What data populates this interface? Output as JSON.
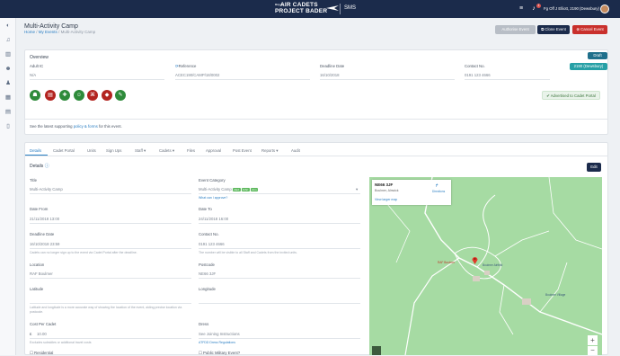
{
  "header": {
    "brand_small": "Royal",
    "brand_line1": "AIR CADETS",
    "brand_line2": "PROJECT BADER",
    "product": "SMS",
    "notification_count": "1",
    "user_name": "Fg Off J Elliott, 2190 (Dewsbury)"
  },
  "page": {
    "title": "Multi-Activity Camp",
    "breadcrumb": {
      "home": "Home",
      "my_events": "My Events",
      "current": "Multi-Activity Camp"
    },
    "buttons": {
      "clone": "Clone Event",
      "cancel": "Cancel Event",
      "disabled": "Authorise Event"
    }
  },
  "overview": {
    "heading": "Overview",
    "status_badge": "Draft",
    "unit_badge": "2190 (Dewsbury)",
    "fields": [
      {
        "label": "Adult IC",
        "value": "N/A"
      },
      {
        "label": "Reference",
        "value": "ACEC190/CAMP/18/0002"
      },
      {
        "label": "Deadline Date",
        "value": "16/10/2018"
      },
      {
        "label": "Contact No.",
        "value": "0191 123 4666"
      }
    ],
    "advertised": "Advertised to Cadet Portal",
    "policy_text_pre": "See the latest supporting",
    "policy_link": "policy & forms",
    "policy_text_post": "for this event."
  },
  "tabs": [
    "Details",
    "Cadet Portal",
    "Units",
    "Sign Ups",
    "Staff",
    "Cadets",
    "Files",
    "Approval",
    "Post Event",
    "Reports",
    "Audit"
  ],
  "details": {
    "heading": "Details",
    "edit_button": "Edit",
    "title_label": "Title",
    "title_value": "Multi-Activity Camp",
    "category_label": "Event Category",
    "category_value": "Multi-Activity Camp",
    "category_badges": [
      "AEA",
      "RAF",
      "Aim"
    ],
    "category_help": "What can I approve?",
    "date_from_label": "Date From",
    "date_from_value": "21/11/2018 13:00",
    "date_to_label": "Date To",
    "date_to_value": "24/11/2018 16:00",
    "deadline_label": "Deadline Date",
    "deadline_value": "16/10/2018 23:59",
    "deadline_help": "Cadets can no longer sign up to the event via Cadet Portal after the deadline.",
    "contact_label": "Contact No.",
    "contact_value": "0191 123 4666",
    "contact_help": "The number will be visible to all Staff and Cadets from the invited units.",
    "location_label": "Location",
    "location_value": "RAF Boulmer",
    "postcode_label": "Postcode",
    "postcode_value": "NE66 3JF",
    "latitude_label": "Latitude",
    "longitude_label": "Longitude",
    "latlong_help": "Latitude and longitude is a more accurate way of showing the location of the event, aiding precise location via postcode.",
    "cost_label": "Cost Per Cadet",
    "cost_currency": "£",
    "cost_value": "10.00",
    "cost_help": "Excludes subsidies or additional travel costs",
    "dress_label": "Dress",
    "dress_value": "See Joining Instructions",
    "dress_help": "ATFDD Dress Regulations",
    "check1": "Residential",
    "check2": "Public Military Event?"
  },
  "map": {
    "place": "NE66 3JF",
    "subtitle": "Boulmer, Alnwick",
    "directions": "Directions",
    "larger": "View larger map",
    "label1": "RAF Boulmer",
    "label2": "Boulmer Airfield",
    "label3": "Boulmer Village"
  }
}
